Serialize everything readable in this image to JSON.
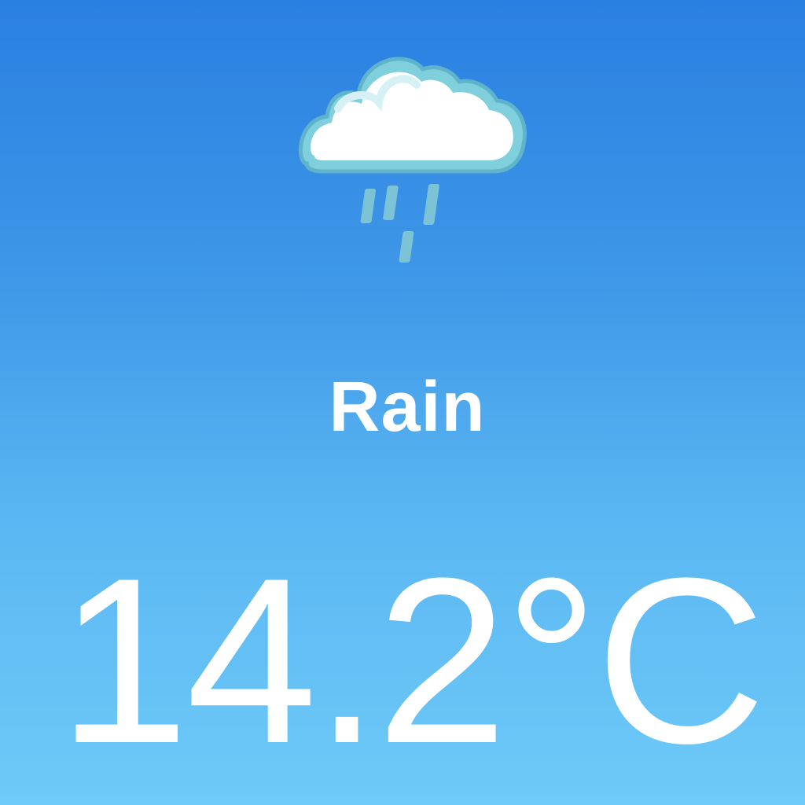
{
  "weather": {
    "icon": "rain-cloud-icon",
    "condition": "Rain",
    "temperature": "14.2°C"
  },
  "colors": {
    "background_top": "#2a7fe0",
    "background_bottom": "#6ecaf7",
    "text": "#ffffff",
    "cloud_fill": "#ffffff",
    "cloud_outline": "#7fcfdc",
    "rain_drops": "#7cc3d6"
  }
}
